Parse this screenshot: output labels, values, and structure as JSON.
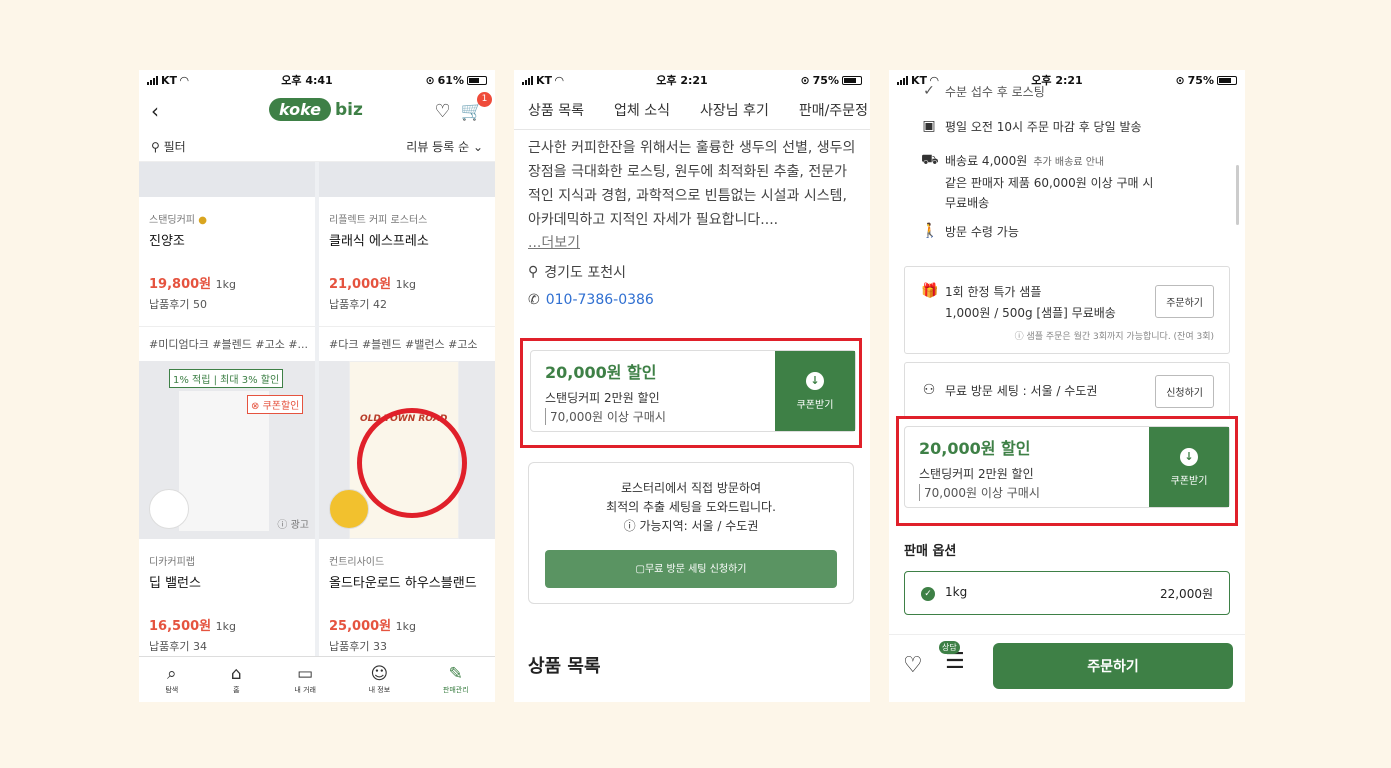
{
  "p1": {
    "status": {
      "carrier": "KT",
      "time": "오후 4:41",
      "battery": "61%"
    },
    "cart_count": "1",
    "logo": {
      "koke": "koke",
      "biz": "biz"
    },
    "filter": "필터",
    "sort": "리뷰 등록 순",
    "products": [
      {
        "seller": "스탠딩커피",
        "name": "진양조",
        "price": "19,800원",
        "unit": "1kg",
        "reviews": "납품후기 50",
        "tags": "#미디엄다크 #블렌드 #고소 #..."
      },
      {
        "seller": "리플렉트 커피 로스터스",
        "name": "클래식 에스프레소",
        "price": "21,000원",
        "unit": "1kg",
        "reviews": "납품후기 42",
        "tags": "#다크 #블렌드 #밸런스 #고소"
      },
      {
        "seller": "디카커피랩",
        "name": "딥 밸런스",
        "price": "16,500원",
        "unit": "1kg",
        "reviews": "납품후기 34",
        "promo1": "1% 적립 | 최대 3% 할인",
        "promo2": "쿠폰할인",
        "ad": "광고"
      },
      {
        "seller": "컨트리사이드",
        "name": "올드타운로드 하우스블랜드",
        "price": "25,000원",
        "unit": "1kg",
        "reviews": "납품후기 33",
        "bag_title": "OLD TOWN ROAD"
      }
    ],
    "tabs": [
      "탐색",
      "홈",
      "내 거래",
      "내 정보",
      "판매관리"
    ]
  },
  "p2": {
    "status": {
      "carrier": "KT",
      "time": "오후 2:21",
      "battery": "75%"
    },
    "tabs": [
      "상품 목록",
      "업체 소식",
      "사장님 후기",
      "판매/주문정"
    ],
    "desc": "근사한 커피한잔을 위해서는 훌륭한 생두의 선별, 생두의 장점을 극대화한 로스팅, 원두에 최적화된 추출, 전문가적인 지식과 경험, 과학적으로 빈틈없는 시설과 시스템, 아카데믹하고 지적인 자세가 필요합니다....",
    "more": "...더보기",
    "location": "경기도 포천시",
    "phone": "010-7386-0386",
    "coupon": {
      "amount": "20,000원 할인",
      "name": "스탠딩커피 2만원 할인",
      "condition": "70,000원 이상 구매시",
      "button": "쿠폰받기"
    },
    "visit": {
      "line1": "로스터리에서 직접 방문하여",
      "line2": "최적의 추출 세팅을 도와드립니다.",
      "area": "가능지역: 서울 / 수도권",
      "button": "무료 방문 세팅 신청하기"
    },
    "section": "상품 목록"
  },
  "p3": {
    "status": {
      "carrier": "KT",
      "time": "오후 2:21",
      "battery": "75%"
    },
    "top": "수분 섭수 후 로스팅",
    "ship1": "평일 오전 10시 주문 마감 후 당일 발송",
    "fee": "배송료 4,000원",
    "fee_sub": "추가 배송료 안내",
    "fee2": "같은 판매자 제품 60,000원 이상 구매 시",
    "fee3": "무료배송",
    "pickup": "방문 수령 가능",
    "sample": {
      "title": "1회 한정 특가 샘플",
      "desc": "1,000원 / 500g [샘플] 무료배송",
      "button": "주문하기",
      "note": "샘플 주문은 월간 3회까지 가능합니다. (잔여 3회)"
    },
    "visit": {
      "label": "무료 방문 세팅 : 서울 / 수도권",
      "button": "신청하기"
    },
    "coupon": {
      "amount": "20,000원 할인",
      "name": "스탠딩커피 2만원 할인",
      "condition": "70,000원 이상 구매시",
      "button": "쿠폰받기"
    },
    "option_title": "판매 옵션",
    "option": {
      "name": "1kg",
      "price": "22,000원"
    },
    "chat_badge": "상담",
    "order": "주문하기"
  }
}
